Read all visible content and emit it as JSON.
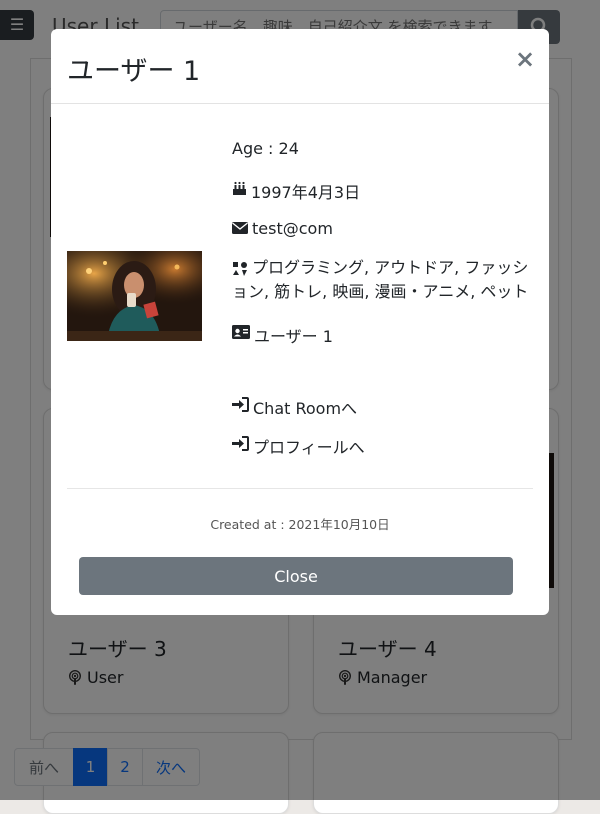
{
  "navbar": {
    "menu_icon": "hamburger-icon",
    "brand": "User List",
    "search_placeholder": "ユーザー名、趣味、自己紹介文 を検索できます",
    "search_icon": "search-icon"
  },
  "cards": [
    {
      "name": "ユーザー 3",
      "role": "User",
      "role_icon": "podcast-icon"
    },
    {
      "name": "ユーザー 4",
      "role": "Manager",
      "role_icon": "podcast-icon"
    }
  ],
  "pagination": {
    "prev": "前へ",
    "pages": [
      "1",
      "2"
    ],
    "active_page": "1",
    "next": "次へ"
  },
  "modal": {
    "title": "ユーザー 1",
    "close_icon": "×",
    "age": "Age : 24",
    "birthday": "1997年4月3日",
    "email": "test@com",
    "hobbies": "プログラミング, アウトドア, ファッション, 筋トレ, 映画, 漫画・アニメ, ペット",
    "name": "ユーザー 1",
    "chat_room_link": "Chat Roomへ",
    "profile_link": "プロフィールへ",
    "created_at": "Created at : 2021年10月10日",
    "close_button": "Close",
    "icons": {
      "birthday": "birthday-cake-icon",
      "email": "envelope-icon",
      "hobbies": "icons-icon",
      "name": "id-card-icon",
      "links": "sign-in-icon"
    }
  },
  "colors": {
    "primary": "#0d6efd",
    "secondary": "#6c757d",
    "dark": "#343a40"
  }
}
